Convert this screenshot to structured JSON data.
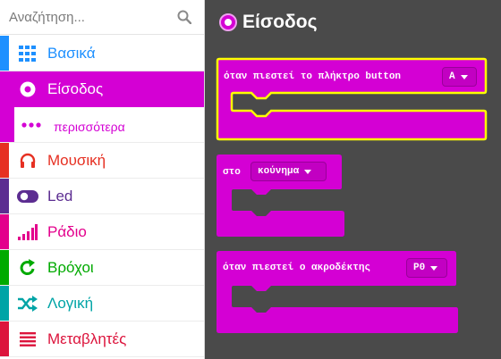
{
  "search": {
    "placeholder": "Αναζήτηση..."
  },
  "categories": [
    {
      "key": "basic",
      "label": "Βασικά",
      "color": "#1e90ff",
      "icon": "grid-icon"
    },
    {
      "key": "input",
      "label": "Είσοδος",
      "color": "#d400d4",
      "icon": "input-circle-icon",
      "selected": true
    },
    {
      "key": "more",
      "label": "περισσότερα",
      "color": "#d400d4",
      "icon": "more-dots-icon",
      "sub": true
    },
    {
      "key": "music",
      "label": "Μουσική",
      "color": "#e63022",
      "icon": "headphones-icon"
    },
    {
      "key": "led",
      "label": "Led",
      "color": "#5c2d91",
      "icon": "toggle-icon"
    },
    {
      "key": "radio",
      "label": "Ράδιο",
      "color": "#e3008c",
      "icon": "signal-bars-icon"
    },
    {
      "key": "loops",
      "label": "Βρόχοι",
      "color": "#00aa00",
      "icon": "loop-arrow-icon"
    },
    {
      "key": "logic",
      "label": "Λογική",
      "color": "#00a4a6",
      "icon": "shuffle-icon"
    },
    {
      "key": "variables",
      "label": "Μεταβλητές",
      "color": "#dc143c",
      "icon": "lines-icon"
    }
  ],
  "workspace": {
    "title": "Είσοδος",
    "accent": "#d400d4",
    "blocks": [
      {
        "text": "όταν πιεστεί το πλήκτρο button",
        "dropdown": "A",
        "highlight": true
      },
      {
        "text": "στο",
        "dropdown": "κούνημα",
        "highlight": false
      },
      {
        "text": "όταν πιεστεί ο ακροδέκτης",
        "dropdown": "P0",
        "highlight": false
      }
    ]
  }
}
